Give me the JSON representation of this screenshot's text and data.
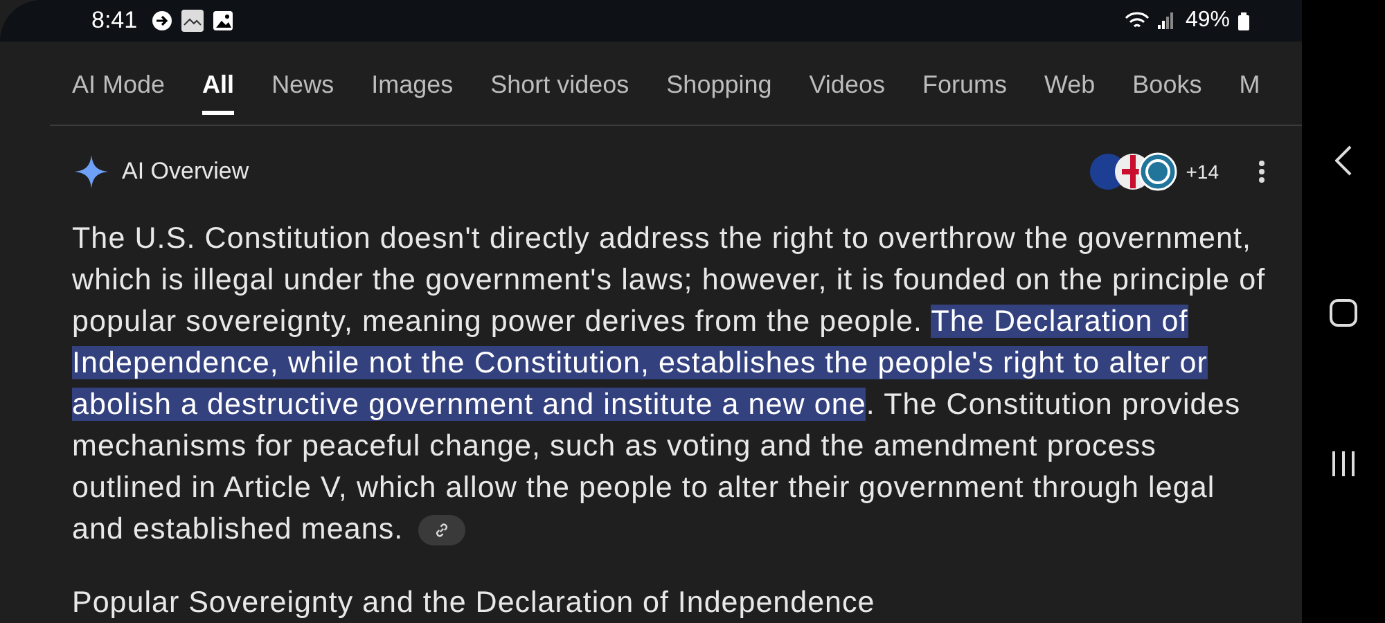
{
  "status_bar": {
    "time": "8:41",
    "battery": "49%"
  },
  "tabs": [
    {
      "label": "AI Mode",
      "selected": false
    },
    {
      "label": "All",
      "selected": true
    },
    {
      "label": "News",
      "selected": false
    },
    {
      "label": "Images",
      "selected": false
    },
    {
      "label": "Short videos",
      "selected": false
    },
    {
      "label": "Shopping",
      "selected": false
    },
    {
      "label": "Videos",
      "selected": false
    },
    {
      "label": "Forums",
      "selected": false
    },
    {
      "label": "Web",
      "selected": false
    },
    {
      "label": "Books",
      "selected": false
    },
    {
      "label": "M",
      "selected": false
    }
  ],
  "overview": {
    "title": "AI Overview",
    "source_count": "+14",
    "paragraph": [
      {
        "text": "The U.S. Constitution doesn't directly address the right to overthrow the government, which is illegal under the government's laws; however, it is founded on the principle of popular sovereignty, meaning power derives from the people. ",
        "highlighted": false
      },
      {
        "text": "The Declaration of Independence, while not the Constitution, establishes the people's right to alter or abolish a destructive government and institute a new one",
        "highlighted": true
      },
      {
        "text": ". The Constitution provides mechanisms for peaceful change, such as voting and the amendment process outlined in Article V, which allow the people to alter their government through legal and established means.",
        "highlighted": false
      }
    ],
    "heading": "Popular Sovereignty and the Declaration of Independence"
  }
}
